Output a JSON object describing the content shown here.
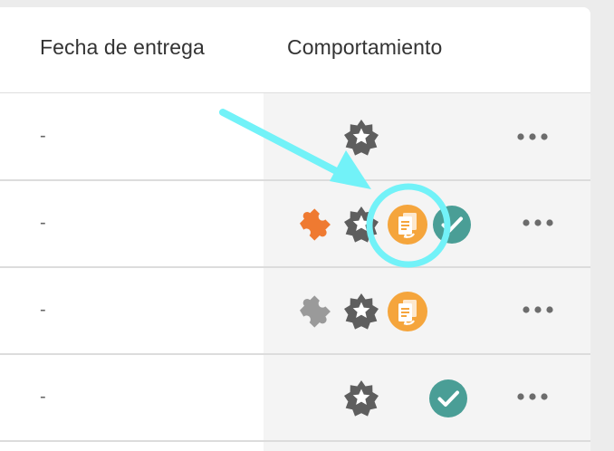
{
  "table": {
    "columns": {
      "delivery_date": "Fecha de entrega",
      "behavior": "Comportamiento"
    },
    "rows": [
      {
        "delivery_date": "-",
        "icons": [
          "star-badge-icon"
        ],
        "actions": "more-options"
      },
      {
        "delivery_date": "-",
        "icons": [
          "puzzle-icon-orange",
          "star-badge-icon",
          "copy-document-icon",
          "check-circle-icon"
        ],
        "actions": "more-options"
      },
      {
        "delivery_date": "-",
        "icons": [
          "puzzle-icon-gray",
          "star-badge-icon",
          "copy-document-icon"
        ],
        "actions": "more-options"
      },
      {
        "delivery_date": "-",
        "icons": [
          "star-badge-icon",
          "check-circle-icon"
        ],
        "actions": "more-options"
      }
    ]
  },
  "colors": {
    "highlight": "#72f2f8",
    "puzzle_orange": "#ef7a31",
    "puzzle_gray": "#9a9a9a",
    "copy_orange": "#f5a53c",
    "check_teal": "#4a9e96",
    "star_gray": "#5e5e5e"
  }
}
